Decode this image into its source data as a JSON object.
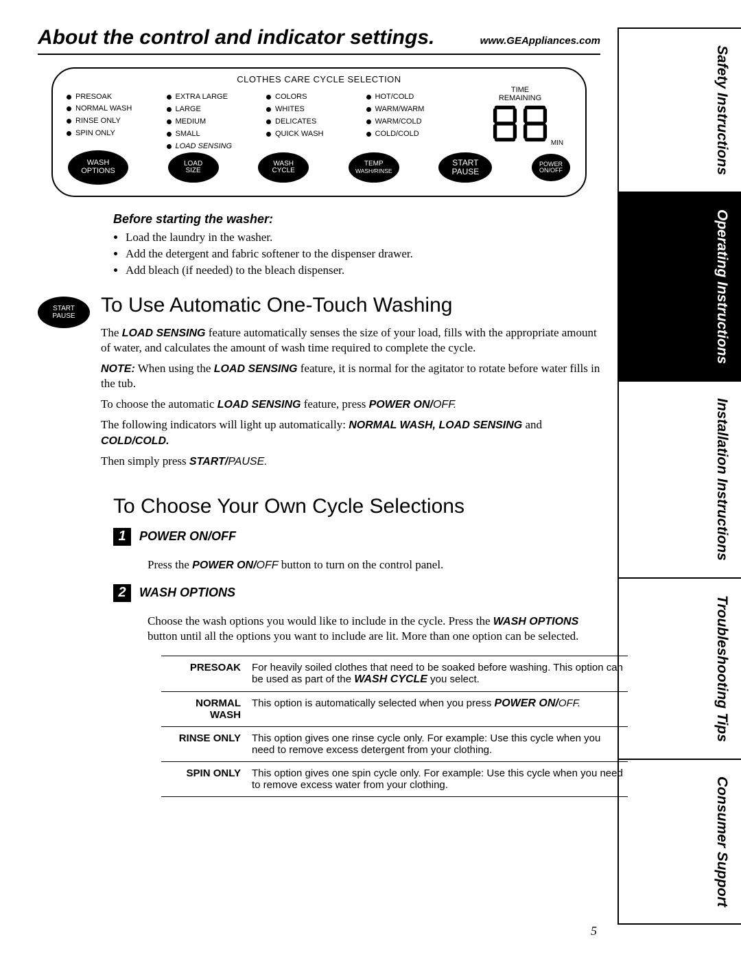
{
  "header": {
    "title": "About the control and indicator settings.",
    "url": "www.GEAppliances.com"
  },
  "sidetabs": [
    {
      "label": "Safety Instructions",
      "active": false
    },
    {
      "label": "Operating Instructions",
      "active": true
    },
    {
      "label": "Installation Instructions",
      "active": false
    },
    {
      "label": "Troubleshooting Tips",
      "active": false
    },
    {
      "label": "Consumer Support",
      "active": false
    }
  ],
  "panel": {
    "title": "CLOTHES CARE CYCLE SELECTION",
    "cols": [
      [
        "PRESOAK",
        "NORMAL WASH",
        "RINSE ONLY",
        "SPIN ONLY"
      ],
      [
        "EXTRA LARGE",
        "LARGE",
        "MEDIUM",
        "SMALL",
        "LOAD SENSING"
      ],
      [
        "COLORS",
        "WHITES",
        "DELICATES",
        "QUICK WASH"
      ],
      [
        "HOT/COLD",
        "WARM/WARM",
        "WARM/COLD",
        "COLD/COLD"
      ]
    ],
    "time_label_1": "TIME",
    "time_label_2": "REMAINING",
    "time_min": "MIN",
    "buttons": {
      "wash_options_1": "WASH",
      "wash_options_2": "OPTIONS",
      "load_1": "LOAD",
      "load_2": "SIZE",
      "wash_1": "WASH",
      "wash_2": "CYCLE",
      "temp_1": "TEMP",
      "temp_2": "WASH/RINSE",
      "start_1": "START",
      "start_2": "PAUSE",
      "power_1": "POWER",
      "power_2": "ON/OFF"
    }
  },
  "before": {
    "heading": "Before starting the washer:",
    "bullets": [
      "Load the laundry in the washer.",
      "Add the detergent and fabric softener to the dispenser drawer.",
      "Add bleach (if needed) to the bleach dispenser."
    ]
  },
  "auto": {
    "badge_1": "START",
    "badge_2": "PAUSE",
    "heading": "To Use Automatic One-Touch Washing",
    "p1_a": "The ",
    "p1_b": "LOAD SENSING",
    "p1_c": " feature automatically senses the size of your load, fills with the appropriate amount of water, and calculates the amount of wash time required to complete the cycle.",
    "p2_a": "NOTE:",
    "p2_b": " When using the ",
    "p2_c": "LOAD SENSING",
    "p2_d": " feature, it is normal for the agitator to rotate before water fills in the tub.",
    "p3_a": "To choose the automatic ",
    "p3_b": "LOAD SENSING",
    "p3_c": " feature, press ",
    "p3_d": "POWER ON/",
    "p3_e": "OFF.",
    "p4_a": "The following indicators will light up automatically: ",
    "p4_b": "NORMAL WASH, LOAD SENSING",
    "p4_c": " and ",
    "p4_d": "COLD/COLD.",
    "p5_a": "Then simply press ",
    "p5_b": "START/",
    "p5_c": "PAUSE."
  },
  "own": {
    "heading": "To Choose Your Own Cycle Selections",
    "step1_title": "POWER ON/OFF",
    "step1_body_a": "Press the ",
    "step1_body_b": "POWER ON/",
    "step1_body_c": "OFF",
    "step1_body_d": " button to turn on the control panel.",
    "step2_title": "WASH OPTIONS",
    "step2_body_a": "Choose the wash options you would like to include in the cycle. Press the ",
    "step2_body_b": "WASH OPTIONS",
    "step2_body_c": " button until all the options you want to include are lit. More than one option can be selected.",
    "table": [
      {
        "name": "PRESOAK",
        "desc_a": "For heavily soiled clothes that need to be soaked before washing. This option can be used as part of the ",
        "desc_b": "WASH CYCLE",
        "desc_c": " you select."
      },
      {
        "name": "NORMAL WASH",
        "desc_a": "This option is automatically selected when you press ",
        "desc_b": "POWER ON/",
        "desc_c": "OFF."
      },
      {
        "name": "RINSE ONLY",
        "desc_a": "This option gives one rinse cycle only. For example: Use this cycle when you need to remove excess detergent from your clothing.",
        "desc_b": "",
        "desc_c": ""
      },
      {
        "name": "SPIN ONLY",
        "desc_a": "This option gives one spin cycle only. For example: Use this cycle when you need to remove excess water from your clothing.",
        "desc_b": "",
        "desc_c": ""
      }
    ]
  },
  "page_number": "5"
}
